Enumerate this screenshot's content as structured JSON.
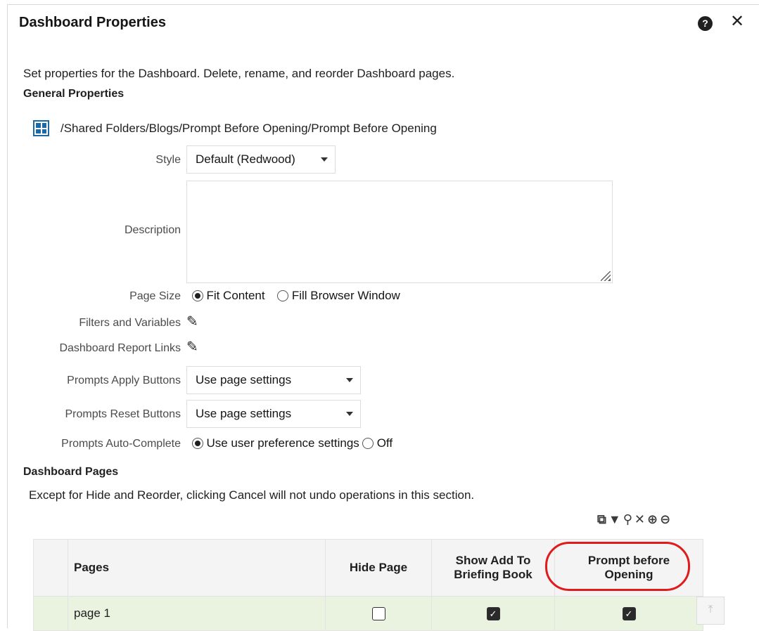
{
  "dialog": {
    "title": "Dashboard Properties",
    "help_icon": "?",
    "close_icon": "✕"
  },
  "intro": "Set properties for the Dashboard. Delete, rename, and reorder Dashboard pages.",
  "general": {
    "heading": "General Properties",
    "path": "/Shared Folders/Blogs/Prompt Before Opening/Prompt Before Opening",
    "style_label": "Style",
    "style_value": "Default (Redwood)",
    "description_label": "Description",
    "description_value": "",
    "page_size_label": "Page Size",
    "page_size_opt1": "Fit Content",
    "page_size_opt2": "Fill Browser Window",
    "filters_label": "Filters and Variables",
    "report_links_label": "Dashboard Report Links",
    "apply_label": "Prompts Apply Buttons",
    "apply_value": "Use page settings",
    "reset_label": "Prompts Reset Buttons",
    "reset_value": "Use page settings",
    "autocomplete_label": "Prompts Auto-Complete",
    "autocomplete_opt1": "Use user preference settings",
    "autocomplete_opt2": "Off"
  },
  "pages_section": {
    "heading": "Dashboard Pages",
    "note": "Except for Hide and Reorder, clicking Cancel will not undo operations in this section.",
    "columns": [
      "Pages",
      "Hide Page",
      "Show Add To Briefing Book",
      "Prompt before Opening"
    ],
    "col_line1": [
      "Pages",
      "Hide Page",
      "Show Add To",
      "Prompt before"
    ],
    "col_line2": [
      "",
      "",
      "Briefing Book",
      "Opening"
    ],
    "rows": [
      {
        "name": "page 1",
        "hide": false,
        "briefing": true,
        "prompt": true
      }
    ]
  },
  "icons": {
    "toolbar": [
      "rename-icon",
      "filter-icon",
      "key-icon",
      "delete-icon",
      "lock-icon",
      "unlock-icon"
    ],
    "colors": {
      "accent": "#1b6aa5",
      "row_highlight": "#e9f3df",
      "annotation": "#e01b1b"
    }
  }
}
